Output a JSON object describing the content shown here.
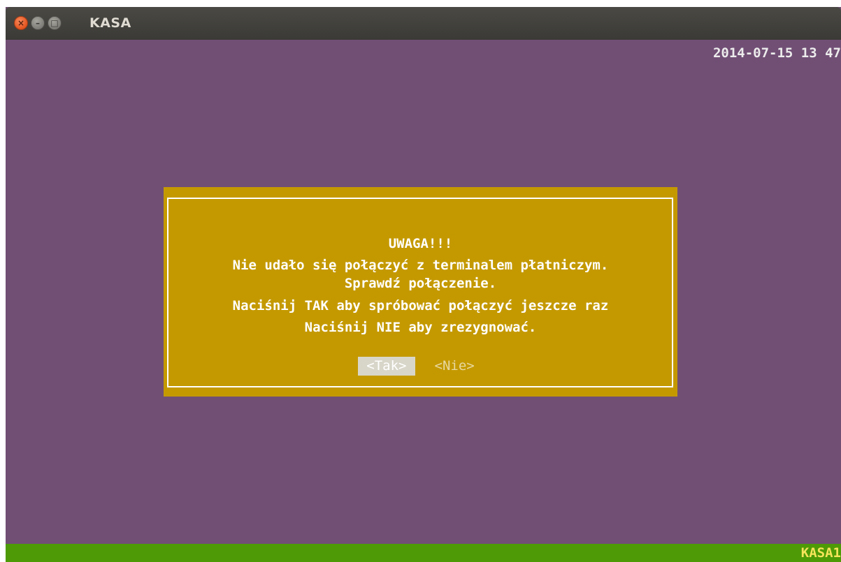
{
  "window": {
    "title": "KASA",
    "close_symbol": "×",
    "minimize_symbol": "–",
    "maximize_symbol": "□"
  },
  "header": {
    "datetime": "2014-07-15 13 47"
  },
  "dialog": {
    "title": "UWAGA!!!",
    "lines": [
      "Nie udało się połączyć z terminalem płatniczym.",
      "Sprawdź połączenie.",
      "Naciśnij TAK aby spróbować połączyć jeszcze raz",
      "Naciśnij NIE aby zrezygnować."
    ],
    "yes_label": "<Tak>",
    "no_label": "<Nie>"
  },
  "statusbar": {
    "station": "KASA1"
  },
  "colors": {
    "background": "#714f75",
    "dialog": "#c49900",
    "statusbar": "#4d9a06",
    "station_text": "#f5e45a",
    "selected_button_bg": "#d8d6c9"
  }
}
